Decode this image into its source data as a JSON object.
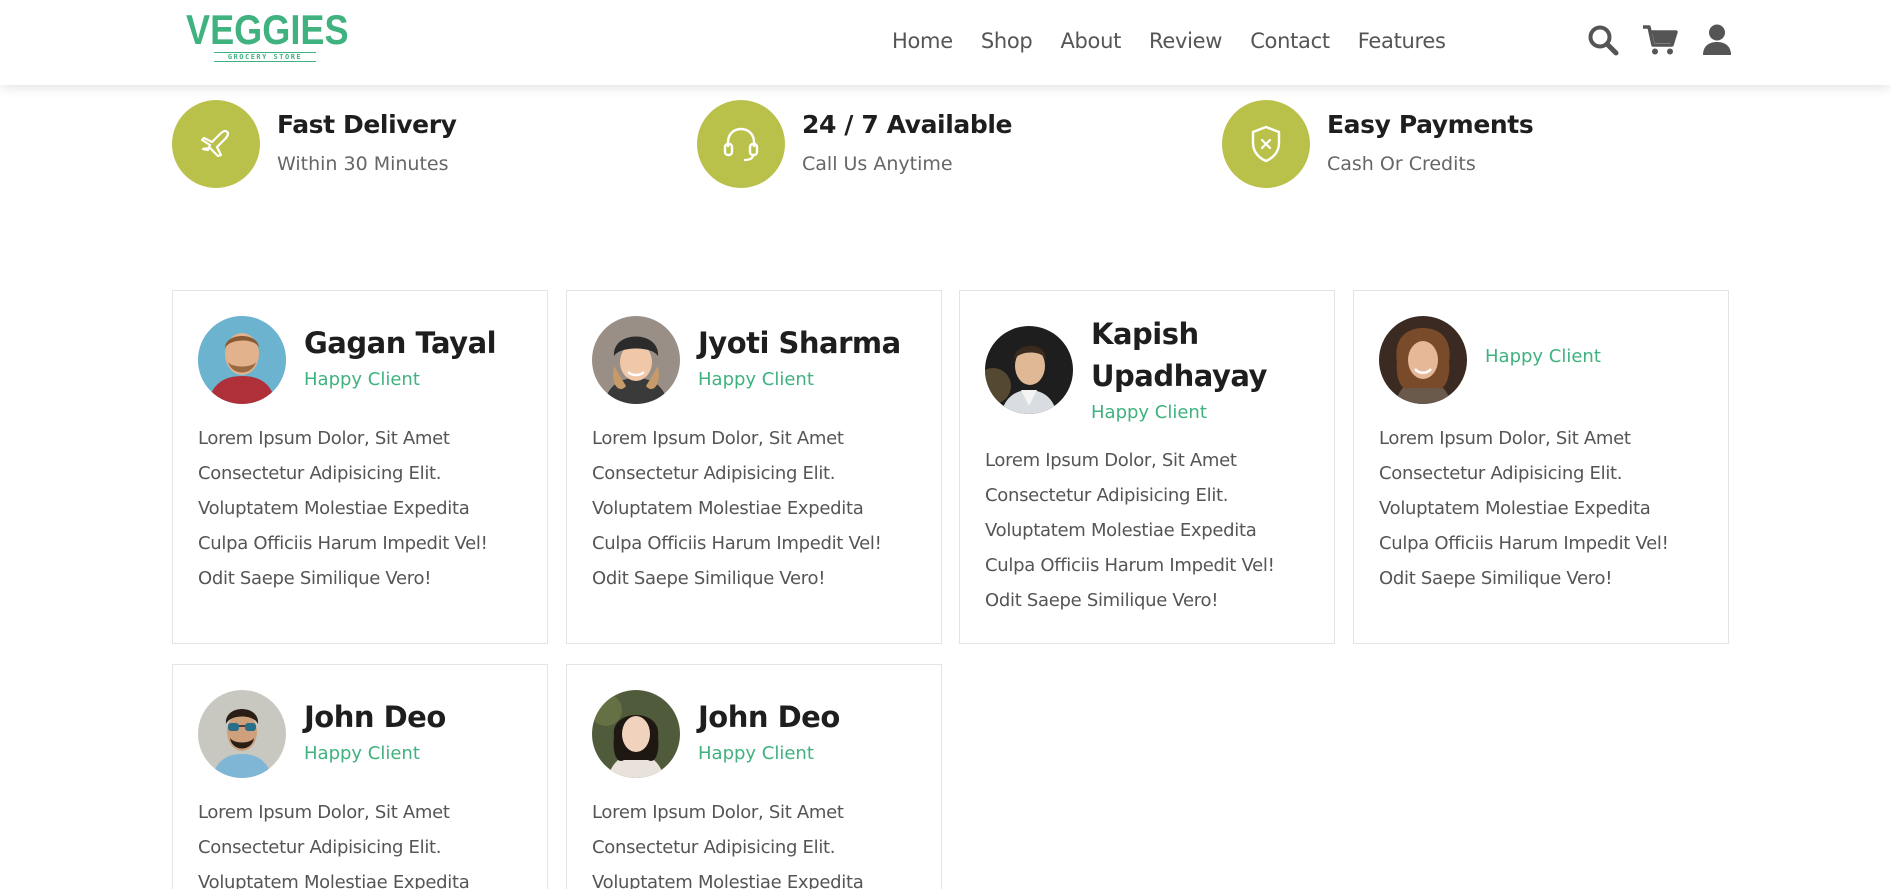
{
  "brand": {
    "name": "VEGGIES",
    "tagline": "GROCERY STORE",
    "color": "#3fb27f"
  },
  "nav": {
    "items": [
      "Home",
      "Shop",
      "About",
      "Review",
      "Contact",
      "Features"
    ]
  },
  "header_icons": [
    "search-icon",
    "cart-icon",
    "user-icon"
  ],
  "features": [
    {
      "icon": "plane-icon",
      "title": "Fast Delivery",
      "subtitle": "Within 30 Minutes"
    },
    {
      "icon": "headset-icon",
      "title": "24 / 7 Available",
      "subtitle": "Call Us Anytime"
    },
    {
      "icon": "shield-icon",
      "title": "Easy Payments",
      "subtitle": "Cash Or Credits"
    }
  ],
  "reviews": [
    {
      "name": "Gagan Tayal",
      "role": "Happy Client",
      "text": [
        "Lorem Ipsum Dolor, Sit Amet",
        "Consectetur Adipisicing Elit.",
        "Voluptatem Molestiae Expedita",
        "Culpa Officiis Harum Impedit Vel!",
        "Odit Saepe Similique Vero!"
      ]
    },
    {
      "name": "Jyoti Sharma",
      "role": "Happy Client",
      "text": [
        "Lorem Ipsum Dolor, Sit Amet",
        "Consectetur Adipisicing Elit.",
        "Voluptatem Molestiae Expedita",
        "Culpa Officiis Harum Impedit Vel!",
        "Odit Saepe Similique Vero!"
      ]
    },
    {
      "name_line1": "Kapish",
      "name_line2": "Upadhayay",
      "role": "Happy Client",
      "text": [
        "Lorem Ipsum Dolor, Sit Amet",
        "Consectetur Adipisicing Elit.",
        "Voluptatem Molestiae Expedita",
        "Culpa Officiis Harum Impedit Vel!",
        "Odit Saepe Similique Vero!"
      ]
    },
    {
      "name": "",
      "role": "Happy Client",
      "text": [
        "Lorem Ipsum Dolor, Sit Amet",
        "Consectetur Adipisicing Elit.",
        "Voluptatem Molestiae Expedita",
        "Culpa Officiis Harum Impedit Vel!",
        "Odit Saepe Similique Vero!"
      ]
    },
    {
      "name": "John Deo",
      "role": "Happy Client",
      "text": [
        "Lorem Ipsum Dolor, Sit Amet",
        "Consectetur Adipisicing Elit.",
        "Voluptatem Molestiae Expedita"
      ]
    },
    {
      "name": "John Deo",
      "role": "Happy Client",
      "text": [
        "Lorem Ipsum Dolor, Sit Amet",
        "Consectetur Adipisicing Elit.",
        "Voluptatem Molestiae Expedita"
      ]
    }
  ],
  "colors": {
    "accent": "#3fb27f",
    "badge": "#b9c14a",
    "icon": "#555555"
  }
}
